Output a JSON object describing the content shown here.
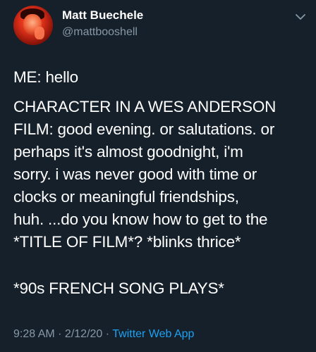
{
  "author": {
    "name": "Matt Buechele",
    "handle": "@mattbooshell"
  },
  "tweet": {
    "line_intro": "ME: hello",
    "character_lines": [
      "CHARACTER IN A WES ANDERSON",
      "FILM: good evening. or salutations. or",
      "perhaps it's almost goodnight, i'm",
      "sorry. i was never good with time or",
      "clocks or meaningful friendships,",
      "huh. ...do you know how to get to the",
      "*TITLE OF FILM*? *blinks thrice*"
    ],
    "closing_line": "*90s FRENCH SONG PLAYS*"
  },
  "meta": {
    "time": "9:28 AM",
    "separator1": " · ",
    "date": "2/12/20",
    "separator2": " · ",
    "app": "Twitter Web App"
  },
  "icons": {
    "avatar": "profile-photo",
    "menu": "chevron-down-icon"
  },
  "colors": {
    "background": "#15202b",
    "primary_text": "#ffffff",
    "secondary_text": "#8899a6",
    "link": "#1da1f2"
  }
}
